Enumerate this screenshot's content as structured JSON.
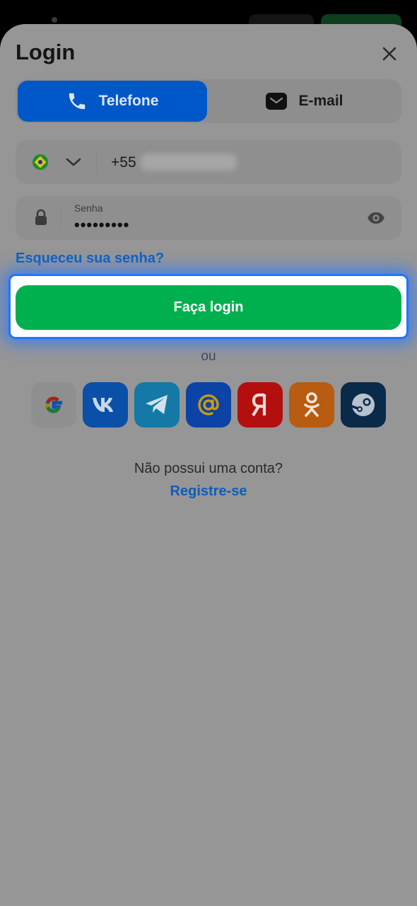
{
  "modal": {
    "title": "Login"
  },
  "tabs": [
    {
      "label": "Telefone",
      "icon": "phone-icon",
      "active": true
    },
    {
      "label": "E-mail",
      "icon": "mail-icon",
      "active": false
    }
  ],
  "phone": {
    "country": "brazil-flag-icon",
    "prefix": "+55"
  },
  "password": {
    "label": "Senha",
    "value": "•••••••••"
  },
  "links": {
    "forgot": "Esqueceu sua senha?",
    "no_account": "Não possui uma conta?",
    "register": "Registre-se"
  },
  "buttons": {
    "login": "Faça login",
    "or": "ou"
  },
  "socials": [
    {
      "name": "google",
      "color": "#8f8f8f"
    },
    {
      "name": "vk",
      "color": "#0a4fa8"
    },
    {
      "name": "telegram",
      "color": "#1479a7"
    },
    {
      "name": "mail-ru",
      "color": "#0c43a6"
    },
    {
      "name": "yandex",
      "color": "#b40f0f"
    },
    {
      "name": "odnoklassniki",
      "color": "#b75c10"
    },
    {
      "name": "steam",
      "color": "#0a2a4a"
    }
  ],
  "colors": {
    "accent_blue": "#0057c8",
    "login_green": "#00b04e",
    "focus_ring": "#1f75ff"
  }
}
